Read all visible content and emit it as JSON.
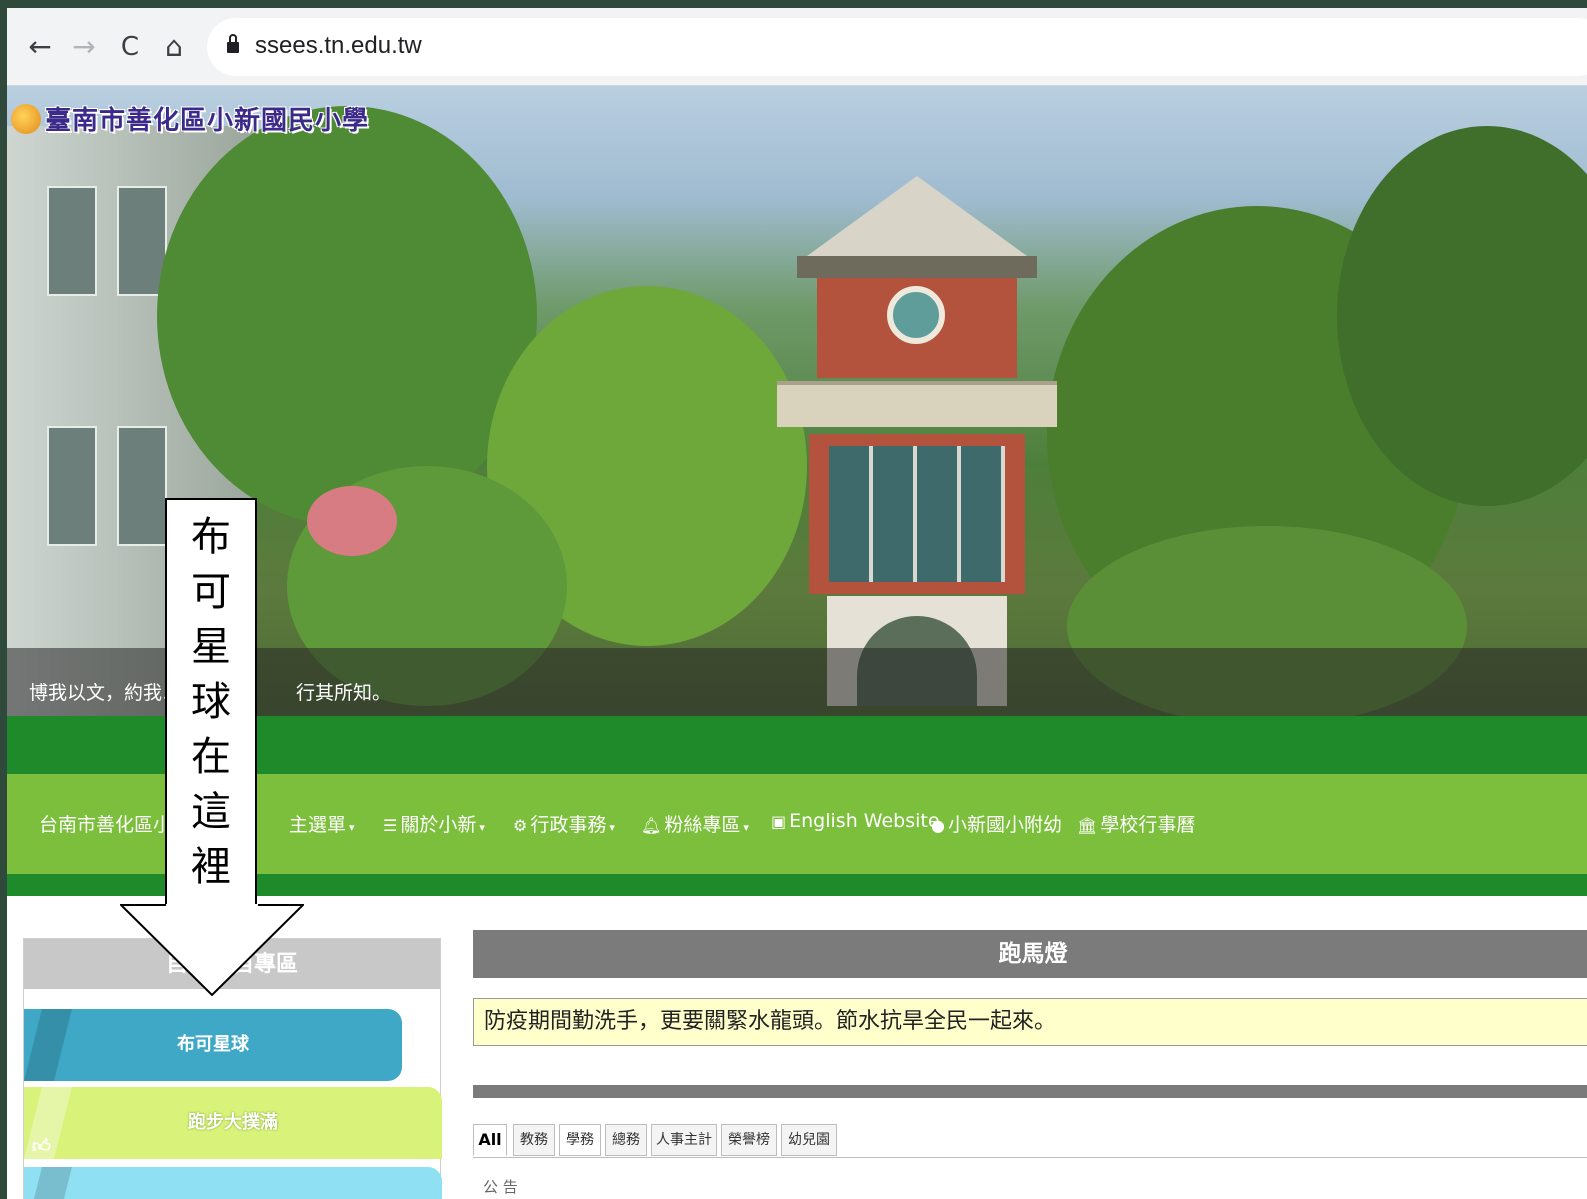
{
  "browser": {
    "back_icon": "←",
    "forward_icon": "→",
    "reload_icon": "C",
    "home_icon": "⌂",
    "url": "ssees.tn.edu.tw"
  },
  "banner": {
    "school_name": "臺南市善化區小新國民小學",
    "motto_part1": "博我以文，約我以禮",
    "motto_part2": "行其所知。"
  },
  "nav": {
    "items": [
      {
        "label": "台南市善化區小新",
        "icon": ""
      },
      {
        "label": "主選單",
        "icon": "",
        "caret": "▾"
      },
      {
        "label": "關於小新",
        "icon": "list-icon",
        "caret": "▾"
      },
      {
        "label": "行政事務",
        "icon": "gear-icon",
        "caret": "▾"
      },
      {
        "label": "粉絲專區",
        "icon": "bell-icon",
        "caret": "▾"
      },
      {
        "label": "English Website",
        "icon": "doc-icon"
      },
      {
        "label": "小新國小附幼",
        "icon": "apple-icon"
      },
      {
        "label": "學校行事曆",
        "icon": "bank-icon"
      }
    ]
  },
  "sidebar": {
    "header": "自　　自專區",
    "items": [
      {
        "label": "布可星球",
        "color": "#3fa8c6"
      },
      {
        "label": "跑步大撲滿",
        "color": "#d8f27a"
      },
      {
        "label": "",
        "color": "#8ee0f2"
      }
    ]
  },
  "main": {
    "marquee_title": "跑馬燈",
    "marquee_text": "防疫期間勤洗手，更要關緊水龍頭。節水抗旱全民一起來。",
    "tabs": [
      "All",
      "教務",
      "學務",
      "總務",
      "人事主計",
      "榮譽榜",
      "幼兒園"
    ],
    "tail": "公 告"
  },
  "annotation": {
    "text_chars": [
      "布",
      "可",
      "星",
      "球",
      "在",
      "這",
      "裡"
    ]
  }
}
